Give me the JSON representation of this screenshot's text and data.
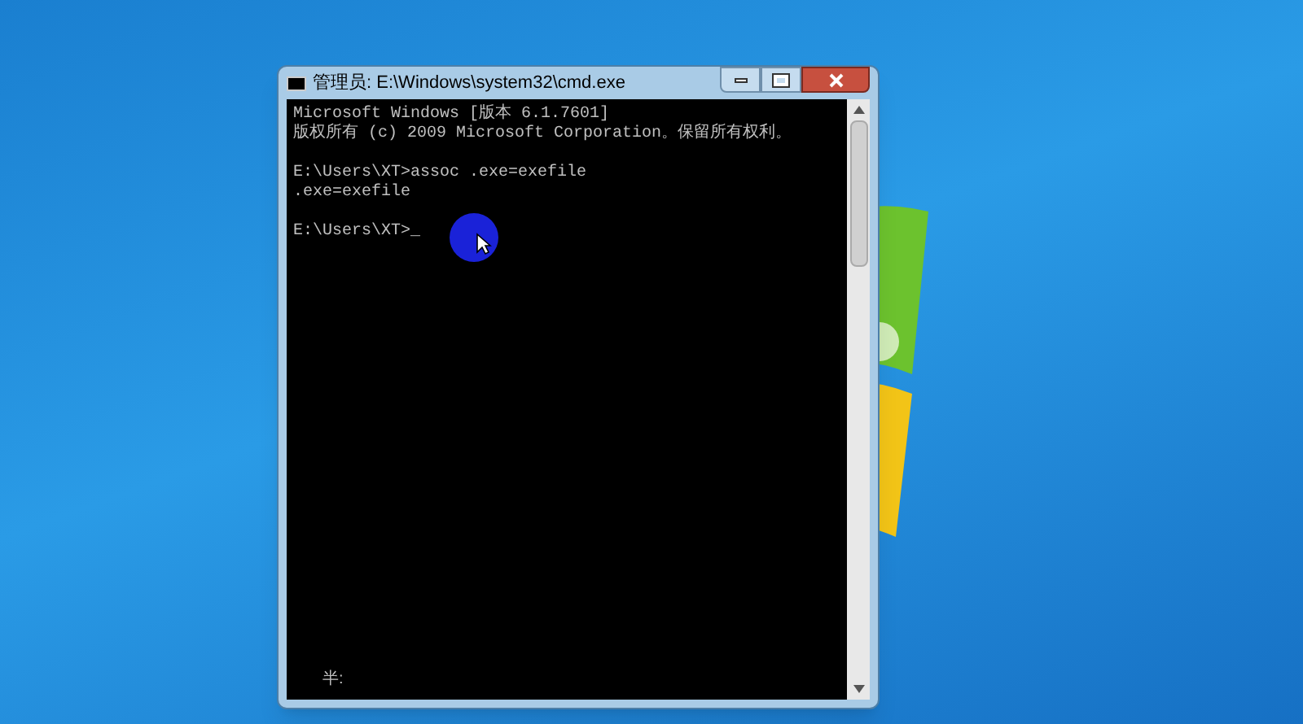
{
  "window": {
    "title": "管理员: E:\\Windows\\system32\\cmd.exe"
  },
  "console": {
    "blocks": [
      [
        "Microsoft Windows [版本 6.1.7601]",
        "版权所有 (c) 2009 Microsoft Corporation。保留所有权利。"
      ],
      [
        "E:\\Users\\XT>assoc .exe=exefile",
        ".exe=exefile"
      ],
      [
        "E:\\Users\\XT>_"
      ]
    ],
    "ime_indicator": "半:"
  }
}
